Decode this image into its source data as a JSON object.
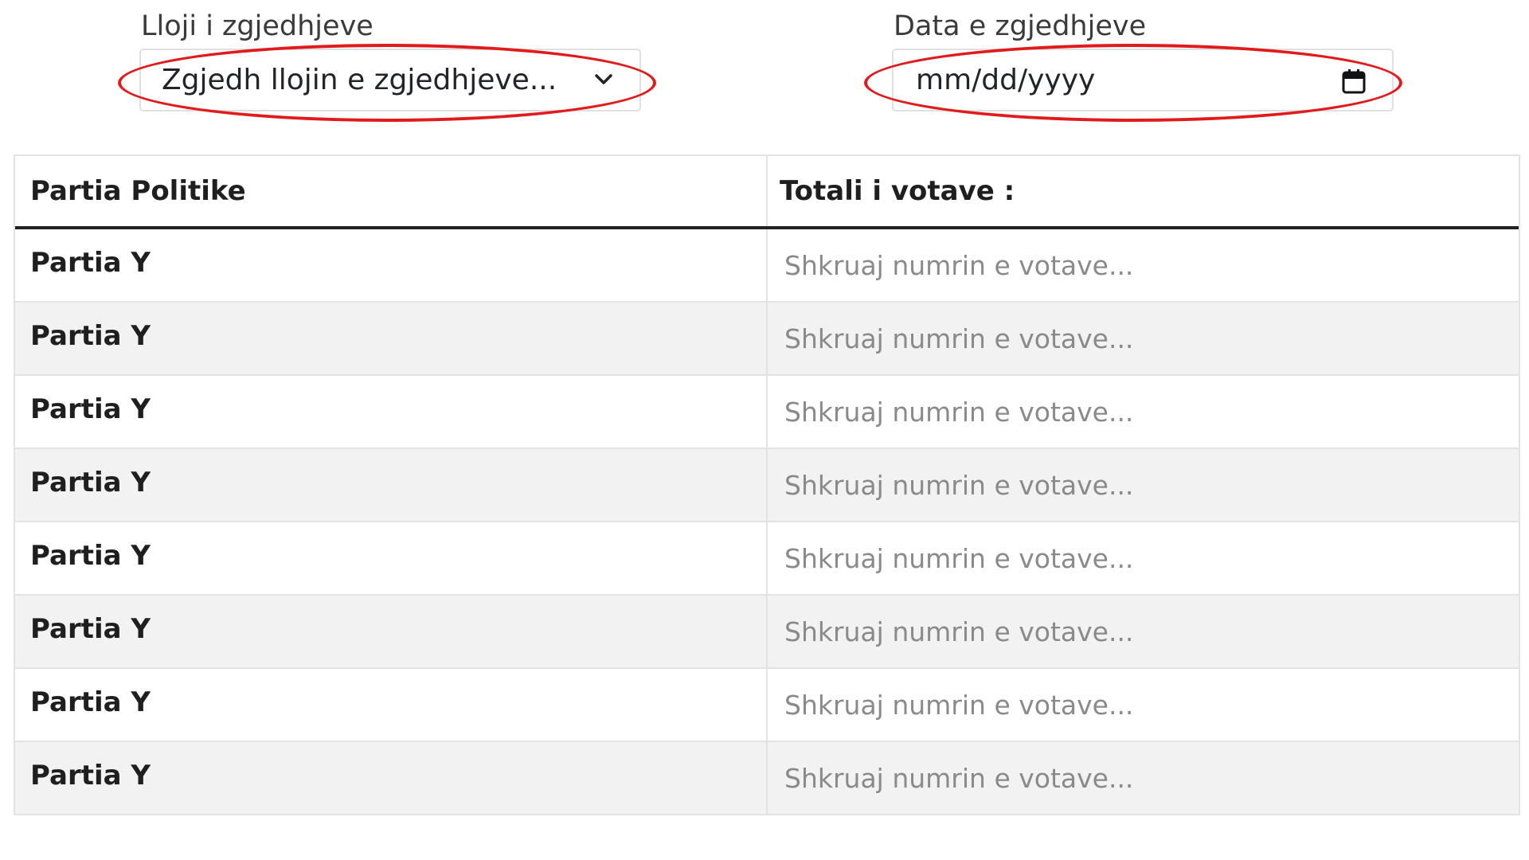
{
  "election_type": {
    "label": "Lloji i zgjedhjeve",
    "selected": "Zgjedh llojin e zgjedhjeve..."
  },
  "election_date": {
    "label": "Data e zgjedhjeve",
    "placeholder": "mm/dd/yyyy"
  },
  "table": {
    "headers": [
      "Partia Politike",
      "Totali i votave :"
    ],
    "rows": [
      {
        "party": "Partia Y",
        "votes_placeholder": "Shkruaj numrin e votave..."
      },
      {
        "party": "Partia Y",
        "votes_placeholder": "Shkruaj numrin e votave..."
      },
      {
        "party": "Partia Y",
        "votes_placeholder": "Shkruaj numrin e votave..."
      },
      {
        "party": "Partia Y",
        "votes_placeholder": "Shkruaj numrin e votave..."
      },
      {
        "party": "Partia Y",
        "votes_placeholder": "Shkruaj numrin e votave..."
      },
      {
        "party": "Partia Y",
        "votes_placeholder": "Shkruaj numrin e votave..."
      },
      {
        "party": "Partia Y",
        "votes_placeholder": "Shkruaj numrin e votave..."
      },
      {
        "party": "Partia Y",
        "votes_placeholder": "Shkruaj numrin e votave..."
      }
    ]
  },
  "colors": {
    "highlight": "#e11b1b",
    "striped_row": "#f2f2f2",
    "border": "#e3e3e3"
  },
  "icons": {
    "select_arrow": "chevron-down-icon",
    "date_picker": "calendar-icon"
  }
}
